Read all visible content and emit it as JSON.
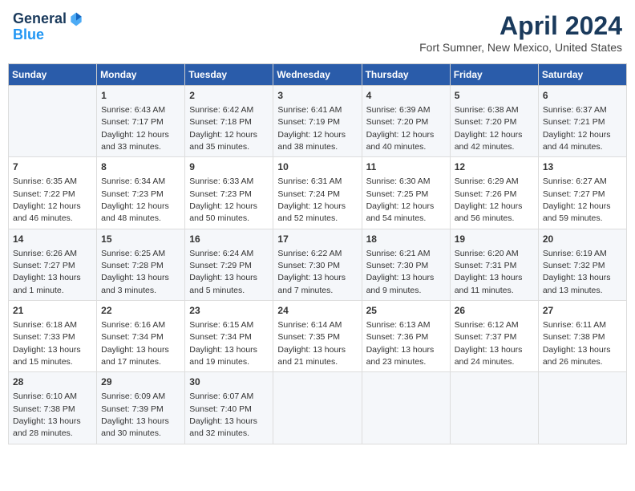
{
  "header": {
    "logo_line1": "General",
    "logo_line2": "Blue",
    "month": "April 2024",
    "location": "Fort Sumner, New Mexico, United States"
  },
  "columns": [
    "Sunday",
    "Monday",
    "Tuesday",
    "Wednesday",
    "Thursday",
    "Friday",
    "Saturday"
  ],
  "weeks": [
    [
      {
        "day": "",
        "info": ""
      },
      {
        "day": "1",
        "info": "Sunrise: 6:43 AM\nSunset: 7:17 PM\nDaylight: 12 hours\nand 33 minutes."
      },
      {
        "day": "2",
        "info": "Sunrise: 6:42 AM\nSunset: 7:18 PM\nDaylight: 12 hours\nand 35 minutes."
      },
      {
        "day": "3",
        "info": "Sunrise: 6:41 AM\nSunset: 7:19 PM\nDaylight: 12 hours\nand 38 minutes."
      },
      {
        "day": "4",
        "info": "Sunrise: 6:39 AM\nSunset: 7:20 PM\nDaylight: 12 hours\nand 40 minutes."
      },
      {
        "day": "5",
        "info": "Sunrise: 6:38 AM\nSunset: 7:20 PM\nDaylight: 12 hours\nand 42 minutes."
      },
      {
        "day": "6",
        "info": "Sunrise: 6:37 AM\nSunset: 7:21 PM\nDaylight: 12 hours\nand 44 minutes."
      }
    ],
    [
      {
        "day": "7",
        "info": "Sunrise: 6:35 AM\nSunset: 7:22 PM\nDaylight: 12 hours\nand 46 minutes."
      },
      {
        "day": "8",
        "info": "Sunrise: 6:34 AM\nSunset: 7:23 PM\nDaylight: 12 hours\nand 48 minutes."
      },
      {
        "day": "9",
        "info": "Sunrise: 6:33 AM\nSunset: 7:23 PM\nDaylight: 12 hours\nand 50 minutes."
      },
      {
        "day": "10",
        "info": "Sunrise: 6:31 AM\nSunset: 7:24 PM\nDaylight: 12 hours\nand 52 minutes."
      },
      {
        "day": "11",
        "info": "Sunrise: 6:30 AM\nSunset: 7:25 PM\nDaylight: 12 hours\nand 54 minutes."
      },
      {
        "day": "12",
        "info": "Sunrise: 6:29 AM\nSunset: 7:26 PM\nDaylight: 12 hours\nand 56 minutes."
      },
      {
        "day": "13",
        "info": "Sunrise: 6:27 AM\nSunset: 7:27 PM\nDaylight: 12 hours\nand 59 minutes."
      }
    ],
    [
      {
        "day": "14",
        "info": "Sunrise: 6:26 AM\nSunset: 7:27 PM\nDaylight: 13 hours\nand 1 minute."
      },
      {
        "day": "15",
        "info": "Sunrise: 6:25 AM\nSunset: 7:28 PM\nDaylight: 13 hours\nand 3 minutes."
      },
      {
        "day": "16",
        "info": "Sunrise: 6:24 AM\nSunset: 7:29 PM\nDaylight: 13 hours\nand 5 minutes."
      },
      {
        "day": "17",
        "info": "Sunrise: 6:22 AM\nSunset: 7:30 PM\nDaylight: 13 hours\nand 7 minutes."
      },
      {
        "day": "18",
        "info": "Sunrise: 6:21 AM\nSunset: 7:30 PM\nDaylight: 13 hours\nand 9 minutes."
      },
      {
        "day": "19",
        "info": "Sunrise: 6:20 AM\nSunset: 7:31 PM\nDaylight: 13 hours\nand 11 minutes."
      },
      {
        "day": "20",
        "info": "Sunrise: 6:19 AM\nSunset: 7:32 PM\nDaylight: 13 hours\nand 13 minutes."
      }
    ],
    [
      {
        "day": "21",
        "info": "Sunrise: 6:18 AM\nSunset: 7:33 PM\nDaylight: 13 hours\nand 15 minutes."
      },
      {
        "day": "22",
        "info": "Sunrise: 6:16 AM\nSunset: 7:34 PM\nDaylight: 13 hours\nand 17 minutes."
      },
      {
        "day": "23",
        "info": "Sunrise: 6:15 AM\nSunset: 7:34 PM\nDaylight: 13 hours\nand 19 minutes."
      },
      {
        "day": "24",
        "info": "Sunrise: 6:14 AM\nSunset: 7:35 PM\nDaylight: 13 hours\nand 21 minutes."
      },
      {
        "day": "25",
        "info": "Sunrise: 6:13 AM\nSunset: 7:36 PM\nDaylight: 13 hours\nand 23 minutes."
      },
      {
        "day": "26",
        "info": "Sunrise: 6:12 AM\nSunset: 7:37 PM\nDaylight: 13 hours\nand 24 minutes."
      },
      {
        "day": "27",
        "info": "Sunrise: 6:11 AM\nSunset: 7:38 PM\nDaylight: 13 hours\nand 26 minutes."
      }
    ],
    [
      {
        "day": "28",
        "info": "Sunrise: 6:10 AM\nSunset: 7:38 PM\nDaylight: 13 hours\nand 28 minutes."
      },
      {
        "day": "29",
        "info": "Sunrise: 6:09 AM\nSunset: 7:39 PM\nDaylight: 13 hours\nand 30 minutes."
      },
      {
        "day": "30",
        "info": "Sunrise: 6:07 AM\nSunset: 7:40 PM\nDaylight: 13 hours\nand 32 minutes."
      },
      {
        "day": "",
        "info": ""
      },
      {
        "day": "",
        "info": ""
      },
      {
        "day": "",
        "info": ""
      },
      {
        "day": "",
        "info": ""
      }
    ]
  ]
}
